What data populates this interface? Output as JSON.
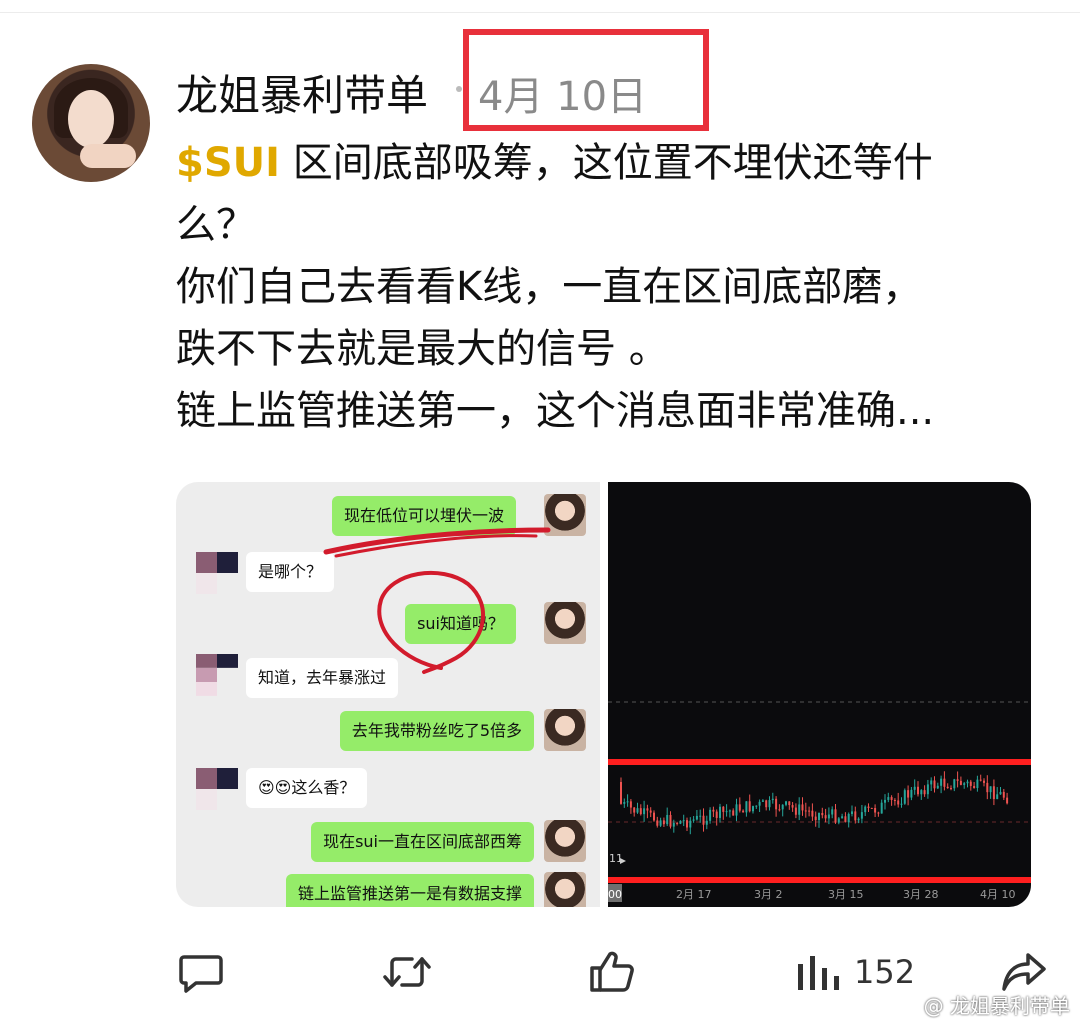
{
  "post": {
    "author": "龙姐暴利带单",
    "date": "4月 10日",
    "cashtag": "$SUI",
    "lines": [
      " 区间底部吸筹，这位置不埋伏还等什",
      "么？",
      "你们自己去看看K线，一直在区间底部磨，",
      "跌不下去就是最大的信号 。",
      "链上监管推送第一，这个消息面非常准确..."
    ]
  },
  "chat": {
    "messages": [
      {
        "side": "right",
        "text": "现在低位可以埋伏一波"
      },
      {
        "side": "left",
        "text": "是哪个？"
      },
      {
        "side": "right",
        "text": "sui知道吗？"
      },
      {
        "side": "left",
        "text": "知道，去年暴涨过"
      },
      {
        "side": "right",
        "text": "去年我带粉丝吃了5倍多"
      },
      {
        "side": "left",
        "text": "😍😍这么香？"
      },
      {
        "side": "right",
        "text": "现在sui一直在区间底部西筹"
      },
      {
        "side": "right",
        "text": "链上监管推送第一是有数据支撑"
      }
    ]
  },
  "chart_data": {
    "type": "candlestick",
    "x_tick_labels": [
      "00",
      "2月 17",
      "3月 2",
      "3月 15",
      "3月 28",
      "4月 10"
    ],
    "left_marker_label": "11",
    "upper_support_line": "red",
    "lower_support_line": "red",
    "grid": "dashed horizontal",
    "colors": {
      "up": "#26a69a",
      "down": "#ef5350",
      "band": "#ff1f1f"
    }
  },
  "actions": {
    "reply_icon": "comment-icon",
    "repost_icon": "repost-icon",
    "like_icon": "thumbs-up-icon",
    "views_icon": "bar-chart-icon",
    "view_count": "152",
    "share_icon": "share-icon"
  },
  "watermark": "@ 龙姐暴利带单",
  "colors": {
    "accent_cashtag": "#e0a800",
    "highlight_red": "#e8303b",
    "wechat_green": "#95ec69"
  }
}
